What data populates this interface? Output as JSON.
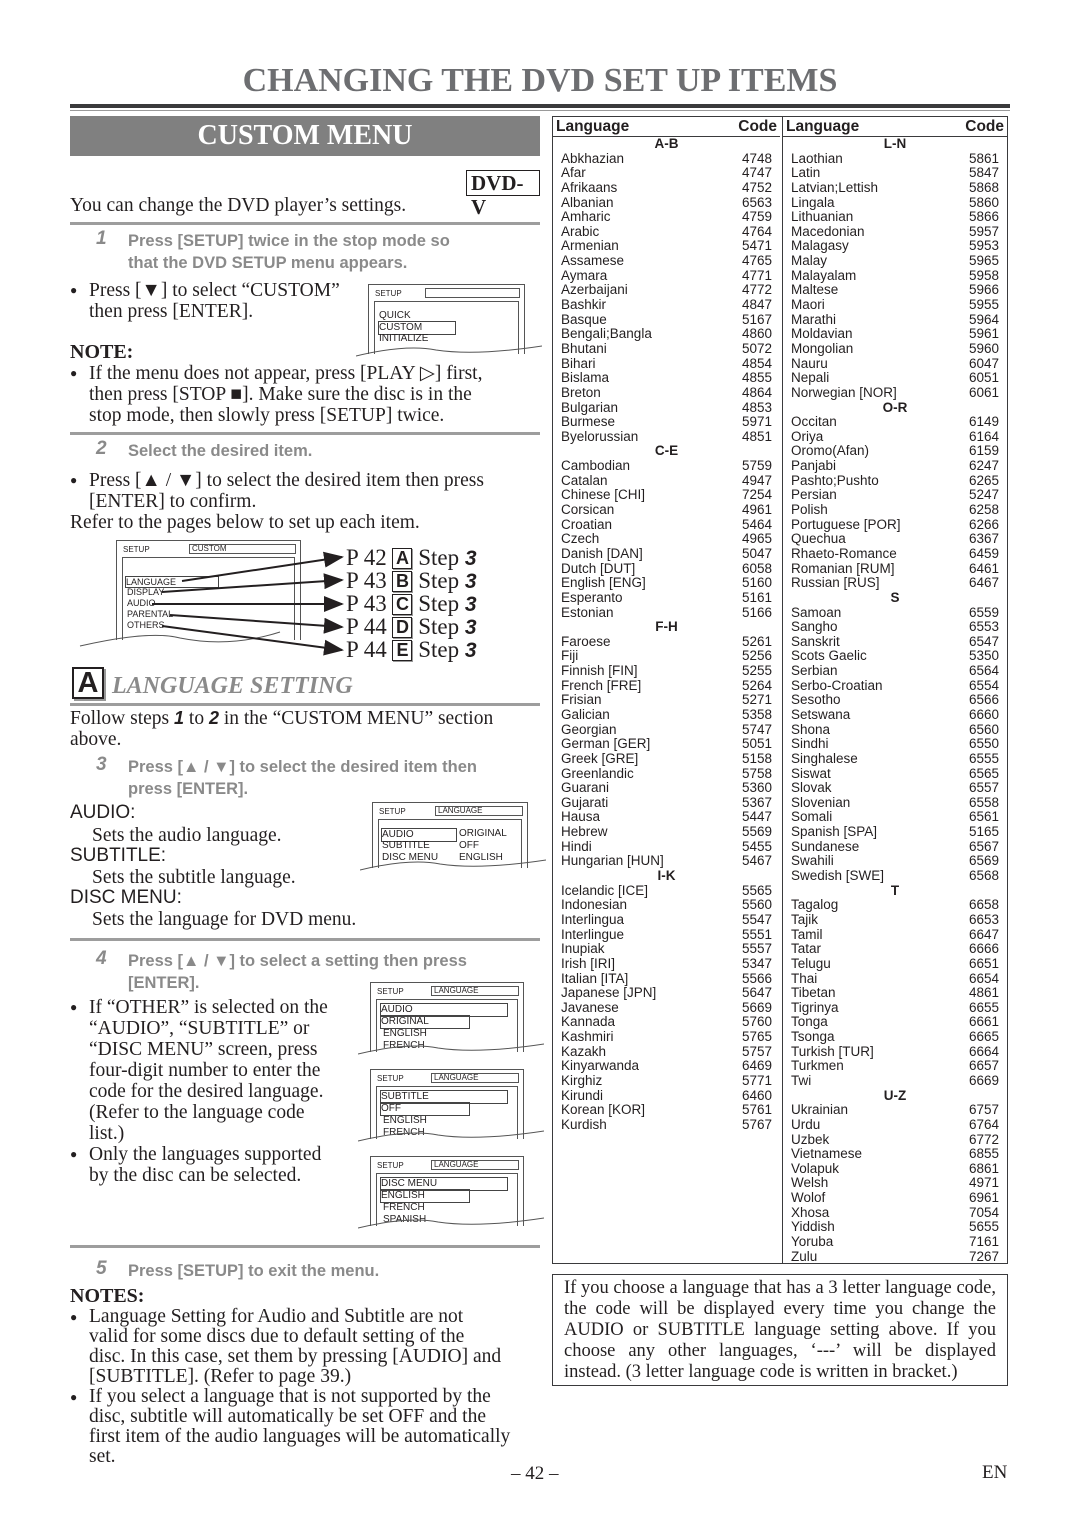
{
  "page": {
    "title": "CHANGING THE DVD SET UP ITEMS",
    "page_number": "– 42 –",
    "language_label": "EN"
  },
  "custom_menu": {
    "banner": "CUSTOM MENU",
    "badge": "DVD-V",
    "intro": "You can change the DVD player’s settings.",
    "step1": {
      "num": "1",
      "text_line1": "Press [SETUP] twice in the stop mode so",
      "text_line2": "that the DVD SETUP menu appears.",
      "bullet_line1": "Press [▼] to select “CUSTOM”",
      "bullet_line2": "then press [ENTER].",
      "note_head": "NOTE:",
      "note_line1": "If the menu does not appear, press [PLAY ▷] first,",
      "note_line2": "then press [STOP ■]. Make sure the disc is in the",
      "note_line3": "stop mode, then slowly press [SETUP] twice.",
      "osd": {
        "setup": "SETUP",
        "title": "",
        "items": [
          "QUICK",
          "CUSTOM",
          "INITIALIZE"
        ],
        "selected": "CUSTOM"
      }
    },
    "step2": {
      "num": "2",
      "text": "Select the desired item.",
      "bullet_line1": "Press [▲ / ▼] to select the desired item then press",
      "bullet_line2": "[ENTER] to confirm.",
      "refer": "Refer to the pages below to set up each item.",
      "osd": {
        "setup": "SETUP",
        "title": "CUSTOM",
        "items": [
          "LANGUAGE",
          "DISPLAY",
          "AUDIO",
          "PARENTAL",
          "OTHERS"
        ]
      },
      "refs": [
        {
          "page": "P 42",
          "letter": "A",
          "step": "Step",
          "step_num": "3"
        },
        {
          "page": "P 43",
          "letter": "B",
          "step": "Step",
          "step_num": "3"
        },
        {
          "page": "P 43",
          "letter": "C",
          "step": "Step",
          "step_num": "3"
        },
        {
          "page": "P 44",
          "letter": "D",
          "step": "Step",
          "step_num": "3"
        },
        {
          "page": "P 44",
          "letter": "E",
          "step": "Step",
          "step_num": "3"
        }
      ]
    }
  },
  "language_setting": {
    "letter": "A",
    "title": "LANGUAGE SETTING",
    "follow_line1_a": "Follow steps ",
    "follow_step1": "1",
    "follow_to": " to ",
    "follow_step2": "2",
    "follow_line1_b": " in the “CUSTOM MENU” section",
    "follow_line2": "above.",
    "step3": {
      "num": "3",
      "text_line1": "Press [▲ / ▼] to select the desired item then",
      "text_line2": "press [ENTER].",
      "audio_head": "AUDIO:",
      "audio_desc": "Sets the audio language.",
      "subtitle_head": "SUBTITLE:",
      "subtitle_desc": "Sets the subtitle language.",
      "discmenu_head": "DISC MENU:",
      "discmenu_desc": "Sets the language for DVD menu.",
      "osd": {
        "setup": "SETUP",
        "title": "LANGUAGE",
        "rows": [
          {
            "item": "AUDIO",
            "value": "ORIGINAL"
          },
          {
            "item": "SUBTITLE",
            "value": "OFF"
          },
          {
            "item": "DISC MENU",
            "value": "ENGLISH"
          }
        ]
      }
    },
    "step4": {
      "num": "4",
      "text_line1": "Press [▲ / ▼] to select a setting then press",
      "text_line2": "[ENTER].",
      "bullet1_lines": [
        "If “OTHER” is selected on the",
        "“AUDIO”, “SUBTITLE” or",
        "“DISC MENU” screen, press",
        "four-digit number to enter the",
        "code for the desired language.",
        "(Refer to the language code",
        "list.)"
      ],
      "bullet2_lines": [
        "Only the languages supported",
        "by the disc can be selected."
      ],
      "osds": [
        {
          "setup": "SETUP",
          "title": "LANGUAGE",
          "header": "AUDIO",
          "selected": "ORIGINAL",
          "options": [
            "ENGLISH",
            "FRENCH"
          ]
        },
        {
          "setup": "SETUP",
          "title": "LANGUAGE",
          "header": "SUBTITLE",
          "selected": "OFF",
          "options": [
            "ENGLISH",
            "FRENCH"
          ]
        },
        {
          "setup": "SETUP",
          "title": "LANGUAGE",
          "header": "DISC MENU",
          "selected": "ENGLISH",
          "options": [
            "FRENCH",
            "SPANISH"
          ]
        }
      ]
    },
    "step5": {
      "num": "5",
      "text": "Press [SETUP] to exit the menu."
    },
    "notes": {
      "head": "NOTES:",
      "note1_lines": [
        "Language Setting for Audio and Subtitle are not",
        "valid for some discs due to default setting of the",
        "disc. In this case, set them by pressing [AUDIO] and",
        "[SUBTITLE]. (Refer to page 39.)"
      ],
      "note2_lines": [
        "If you select a language that is not supported by the",
        "disc, subtitle will automatically be set OFF and the",
        "first item of the audio languages will be automatically",
        "set."
      ]
    }
  },
  "language_table": {
    "header_language": "Language",
    "header_code": "Code",
    "columns": [
      [
        {
          "group": "A-B"
        },
        {
          "lang": "Abkhazian",
          "code": "4748"
        },
        {
          "lang": "Afar",
          "code": "4747"
        },
        {
          "lang": "Afrikaans",
          "code": "4752"
        },
        {
          "lang": "Albanian",
          "code": "6563"
        },
        {
          "lang": "Amharic",
          "code": "4759"
        },
        {
          "lang": "Arabic",
          "code": "4764"
        },
        {
          "lang": "Armenian",
          "code": "5471"
        },
        {
          "lang": "Assamese",
          "code": "4765"
        },
        {
          "lang": "Aymara",
          "code": "4771"
        },
        {
          "lang": "Azerbaijani",
          "code": "4772"
        },
        {
          "lang": "Bashkir",
          "code": "4847"
        },
        {
          "lang": "Basque",
          "code": "5167"
        },
        {
          "lang": "Bengali;Bangla",
          "code": "4860"
        },
        {
          "lang": "Bhutani",
          "code": "5072"
        },
        {
          "lang": "Bihari",
          "code": "4854"
        },
        {
          "lang": "Bislama",
          "code": "4855"
        },
        {
          "lang": "Breton",
          "code": "4864"
        },
        {
          "lang": "Bulgarian",
          "code": "4853"
        },
        {
          "lang": "Burmese",
          "code": "5971"
        },
        {
          "lang": "Byelorussian",
          "code": "4851"
        },
        {
          "group": "C-E"
        },
        {
          "lang": "Cambodian",
          "code": "5759"
        },
        {
          "lang": "Catalan",
          "code": "4947"
        },
        {
          "lang": "Chinese [CHI]",
          "code": "7254"
        },
        {
          "lang": "Corsican",
          "code": "4961"
        },
        {
          "lang": "Croatian",
          "code": "5464"
        },
        {
          "lang": "Czech",
          "code": "4965"
        },
        {
          "lang": "Danish [DAN]",
          "code": "5047"
        },
        {
          "lang": "Dutch [DUT]",
          "code": "6058"
        },
        {
          "lang": "English [ENG]",
          "code": "5160"
        },
        {
          "lang": "Esperanto",
          "code": "5161"
        },
        {
          "lang": "Estonian",
          "code": "5166"
        },
        {
          "group": "F-H"
        },
        {
          "lang": "Faroese",
          "code": "5261"
        },
        {
          "lang": "Fiji",
          "code": "5256"
        },
        {
          "lang": "Finnish [FIN]",
          "code": "5255"
        },
        {
          "lang": "French [FRE]",
          "code": "5264"
        },
        {
          "lang": "Frisian",
          "code": "5271"
        },
        {
          "lang": "Galician",
          "code": "5358"
        },
        {
          "lang": "Georgian",
          "code": "5747"
        },
        {
          "lang": "German [GER]",
          "code": "5051"
        },
        {
          "lang": "Greek [GRE]",
          "code": "5158"
        },
        {
          "lang": "Greenlandic",
          "code": "5758"
        },
        {
          "lang": "Guarani",
          "code": "5360"
        },
        {
          "lang": "Gujarati",
          "code": "5367"
        },
        {
          "lang": "Hausa",
          "code": "5447"
        },
        {
          "lang": "Hebrew",
          "code": "5569"
        },
        {
          "lang": "Hindi",
          "code": "5455"
        },
        {
          "lang": "Hungarian [HUN]",
          "code": "5467"
        },
        {
          "group": "I-K"
        },
        {
          "lang": "Icelandic [ICE]",
          "code": "5565"
        },
        {
          "lang": "Indonesian",
          "code": "5560"
        },
        {
          "lang": "Interlingua",
          "code": "5547"
        },
        {
          "lang": "Interlingue",
          "code": "5551"
        },
        {
          "lang": "Inupiak",
          "code": "5557"
        },
        {
          "lang": "Irish [IRI]",
          "code": "5347"
        },
        {
          "lang": "Italian [ITA]",
          "code": "5566"
        },
        {
          "lang": "Japanese [JPN]",
          "code": "5647"
        },
        {
          "lang": "Javanese",
          "code": "5669"
        },
        {
          "lang": "Kannada",
          "code": "5760"
        },
        {
          "lang": "Kashmiri",
          "code": "5765"
        },
        {
          "lang": "Kazakh",
          "code": "5757"
        },
        {
          "lang": "Kinyarwanda",
          "code": "6469"
        },
        {
          "lang": "Kirghiz",
          "code": "5771"
        },
        {
          "lang": "Kirundi",
          "code": "6460"
        },
        {
          "lang": "Korean [KOR]",
          "code": "5761"
        },
        {
          "lang": "Kurdish",
          "code": "5767"
        }
      ],
      [
        {
          "group": "L-N"
        },
        {
          "lang": "Laothian",
          "code": "5861"
        },
        {
          "lang": "Latin",
          "code": "5847"
        },
        {
          "lang": "Latvian;Lettish",
          "code": "5868"
        },
        {
          "lang": "Lingala",
          "code": "5860"
        },
        {
          "lang": "Lithuanian",
          "code": "5866"
        },
        {
          "lang": "Macedonian",
          "code": "5957"
        },
        {
          "lang": "Malagasy",
          "code": "5953"
        },
        {
          "lang": "Malay",
          "code": "5965"
        },
        {
          "lang": "Malayalam",
          "code": "5958"
        },
        {
          "lang": "Maltese",
          "code": "5966"
        },
        {
          "lang": "Maori",
          "code": "5955"
        },
        {
          "lang": "Marathi",
          "code": "5964"
        },
        {
          "lang": "Moldavian",
          "code": "5961"
        },
        {
          "lang": "Mongolian",
          "code": "5960"
        },
        {
          "lang": "Nauru",
          "code": "6047"
        },
        {
          "lang": "Nepali",
          "code": "6051"
        },
        {
          "lang": "Norwegian [NOR]",
          "code": "6061"
        },
        {
          "group": "O-R"
        },
        {
          "lang": "Occitan",
          "code": "6149"
        },
        {
          "lang": "Oriya",
          "code": "6164"
        },
        {
          "lang": "Oromo(Afan)",
          "code": "6159"
        },
        {
          "lang": "Panjabi",
          "code": "6247"
        },
        {
          "lang": "Pashto;Pushto",
          "code": "6265"
        },
        {
          "lang": "Persian",
          "code": "5247"
        },
        {
          "lang": "Polish",
          "code": "6258"
        },
        {
          "lang": "Portuguese [POR]",
          "code": "6266"
        },
        {
          "lang": "Quechua",
          "code": "6367"
        },
        {
          "lang": "Rhaeto-Romance",
          "code": "6459"
        },
        {
          "lang": "Romanian [RUM]",
          "code": "6461"
        },
        {
          "lang": "Russian [RUS]",
          "code": "6467"
        },
        {
          "group": "S"
        },
        {
          "lang": "Samoan",
          "code": "6559"
        },
        {
          "lang": "Sangho",
          "code": "6553"
        },
        {
          "lang": "Sanskrit",
          "code": "6547"
        },
        {
          "lang": "Scots Gaelic",
          "code": "5350"
        },
        {
          "lang": "Serbian",
          "code": "6564"
        },
        {
          "lang": "Serbo-Croatian",
          "code": "6554"
        },
        {
          "lang": "Sesotho",
          "code": "6566"
        },
        {
          "lang": "Setswana",
          "code": "6660"
        },
        {
          "lang": "Shona",
          "code": "6560"
        },
        {
          "lang": "Sindhi",
          "code": "6550"
        },
        {
          "lang": "Singhalese",
          "code": "6555"
        },
        {
          "lang": "Siswat",
          "code": "6565"
        },
        {
          "lang": "Slovak",
          "code": "6557"
        },
        {
          "lang": "Slovenian",
          "code": "6558"
        },
        {
          "lang": "Somali",
          "code": "6561"
        },
        {
          "lang": "Spanish [SPA]",
          "code": "5165"
        },
        {
          "lang": "Sundanese",
          "code": "6567"
        },
        {
          "lang": "Swahili",
          "code": "6569"
        },
        {
          "lang": "Swedish [SWE]",
          "code": "6568"
        },
        {
          "group": "T"
        },
        {
          "lang": "Tagalog",
          "code": "6658"
        },
        {
          "lang": "Tajik",
          "code": "6653"
        },
        {
          "lang": "Tamil",
          "code": "6647"
        },
        {
          "lang": "Tatar",
          "code": "6666"
        },
        {
          "lang": "Telugu",
          "code": "6651"
        },
        {
          "lang": "Thai",
          "code": "6654"
        },
        {
          "lang": "Tibetan",
          "code": "4861"
        },
        {
          "lang": "Tigrinya",
          "code": "6655"
        },
        {
          "lang": "Tonga",
          "code": "6661"
        },
        {
          "lang": "Tsonga",
          "code": "6665"
        },
        {
          "lang": "Turkish [TUR]",
          "code": "6664"
        },
        {
          "lang": "Turkmen",
          "code": "6657"
        },
        {
          "lang": "Twi",
          "code": "6669"
        },
        {
          "group": "U-Z"
        },
        {
          "lang": "Ukrainian",
          "code": "6757"
        },
        {
          "lang": "Urdu",
          "code": "6764"
        },
        {
          "lang": "Uzbek",
          "code": "6772"
        },
        {
          "lang": "Vietnamese",
          "code": "6855"
        },
        {
          "lang": "Volapuk",
          "code": "6861"
        },
        {
          "lang": "Welsh",
          "code": "4971"
        },
        {
          "lang": "Wolof",
          "code": "6961"
        },
        {
          "lang": "Xhosa",
          "code": "7054"
        },
        {
          "lang": "Yiddish",
          "code": "5655"
        },
        {
          "lang": "Yoruba",
          "code": "7161"
        },
        {
          "lang": "Zulu",
          "code": "7267"
        }
      ]
    ]
  },
  "info_box": {
    "text": "If you choose a language that has a 3 letter language code, the code will be displayed every time you change the AUDIO or SUBTITLE language setting above. If you choose any other languages, ‘---’ will be displayed instead. (3 letter language code is written in bracket.)"
  }
}
